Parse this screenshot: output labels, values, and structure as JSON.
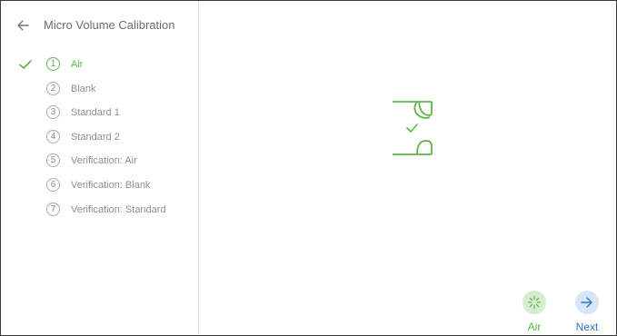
{
  "header": {
    "title": "Micro Volume Calibration",
    "back_icon": "arrow-left-icon"
  },
  "steps": [
    {
      "number": "1",
      "label": "Air",
      "status": "done"
    },
    {
      "number": "2",
      "label": "Blank",
      "status": "pending"
    },
    {
      "number": "3",
      "label": "Standard 1",
      "status": "pending"
    },
    {
      "number": "4",
      "label": "Standard 2",
      "status": "pending"
    },
    {
      "number": "5",
      "label": "Verification: Air",
      "status": "pending"
    },
    {
      "number": "6",
      "label": "Verification: Blank",
      "status": "pending"
    },
    {
      "number": "7",
      "label": "Verification: Standard",
      "status": "pending"
    }
  ],
  "actions": {
    "air_label": "Air",
    "next_label": "Next"
  },
  "colors": {
    "accent_green": "#5cb548",
    "accent_blue": "#3274c1",
    "text_muted": "#8f8f8f"
  }
}
